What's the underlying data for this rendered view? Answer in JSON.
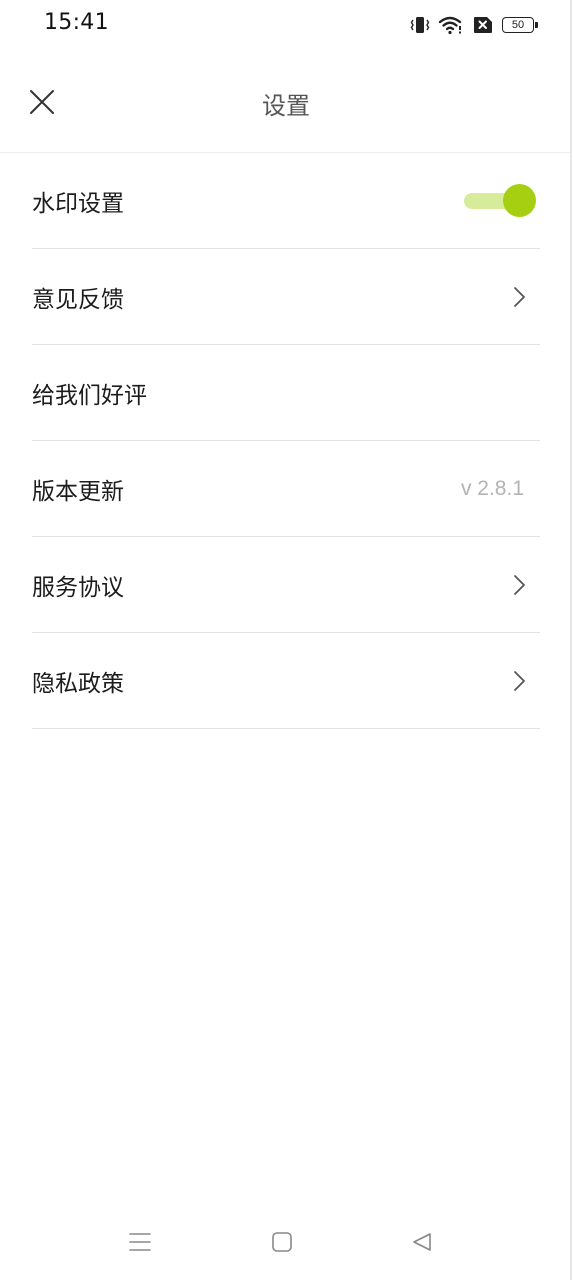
{
  "status_bar": {
    "time": "15:41",
    "battery_level": "50",
    "icons": [
      "vibrate-icon",
      "wifi-icon",
      "no-sim-icon",
      "battery-icon"
    ]
  },
  "header": {
    "title": "设置",
    "close_icon": "close-icon"
  },
  "settings": {
    "watermark": {
      "label": "水印设置",
      "enabled": true
    },
    "feedback": {
      "label": "意见反馈"
    },
    "rate_us": {
      "label": "给我们好评"
    },
    "version_update": {
      "label": "版本更新",
      "value": "v 2.8.1"
    },
    "service_agreement": {
      "label": "服务协议"
    },
    "privacy_policy": {
      "label": "隐私政策"
    }
  },
  "colors": {
    "accent": "#a6cf12",
    "accent_track": "#d6ec9b",
    "divider": "#e2e2e2",
    "secondary_text": "#b3b3b3"
  },
  "nav_bar": {
    "icons": [
      "menu-icon",
      "home-icon",
      "back-icon"
    ]
  }
}
